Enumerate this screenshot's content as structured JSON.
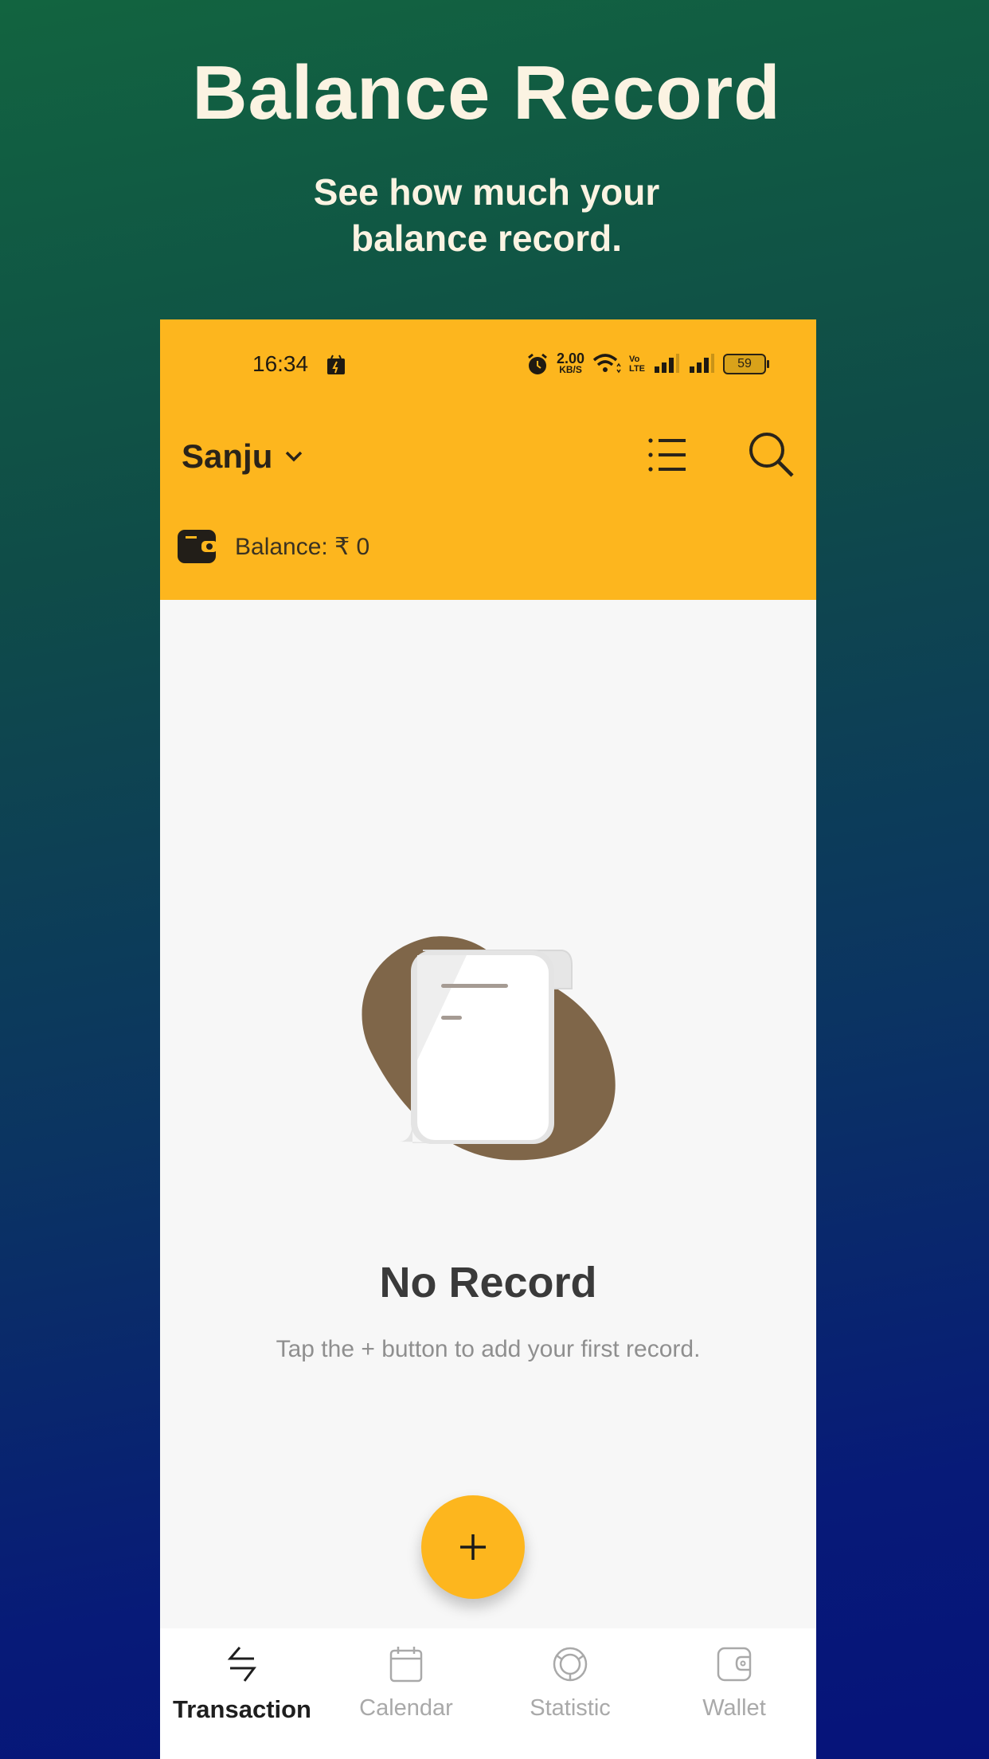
{
  "promo": {
    "title": "Balance Record",
    "subtitle_line1": "See how much your",
    "subtitle_line2": "balance record."
  },
  "status_bar": {
    "time": "16:34",
    "net_speed_value": "2.00",
    "net_speed_unit": "KB/S",
    "volte_line1": "Vo",
    "volte_line2": "LTE",
    "battery": "59"
  },
  "header": {
    "account_name": "Sanju",
    "balance_label": "Balance: ₹ 0"
  },
  "empty_state": {
    "title": "No Record",
    "subtitle": "Tap the + button to add your first record."
  },
  "fab": {
    "label": "+"
  },
  "bottom_nav": {
    "items": [
      {
        "label": "Transaction",
        "icon": "transfer-arrows-icon",
        "active": true
      },
      {
        "label": "Calendar",
        "icon": "calendar-icon",
        "active": false
      },
      {
        "label": "Statistic",
        "icon": "statistic-icon",
        "active": false
      },
      {
        "label": "Wallet",
        "icon": "wallet-icon",
        "active": false
      }
    ]
  },
  "colors": {
    "accent": "#fdb61e",
    "illustration_blob": "#7f6649",
    "bg_gradient_top": "#126440",
    "bg_gradient_bottom": "#06137a",
    "promo_text": "#fbf3e2"
  }
}
